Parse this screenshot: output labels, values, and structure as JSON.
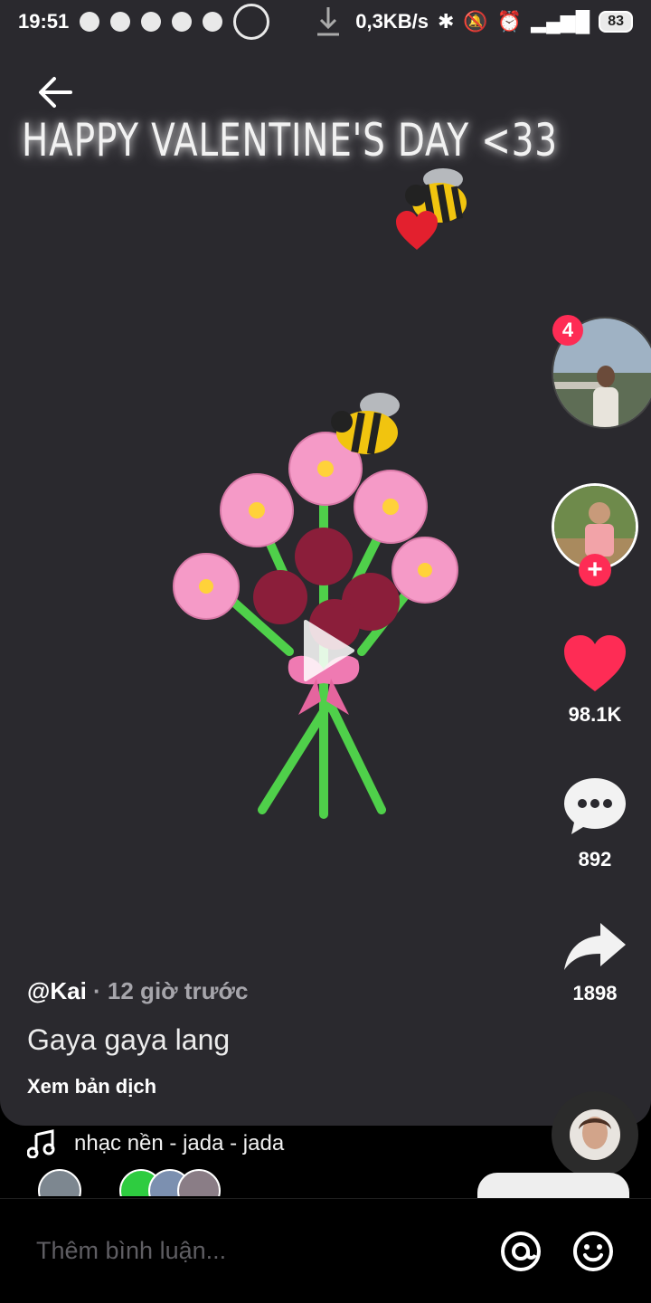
{
  "status_bar": {
    "time": "19:51",
    "network_speed": "0,3KB/s",
    "battery": "83"
  },
  "video": {
    "headline": "HAPPY VALENTINE'S DAY <33",
    "play_icon": "play-icon"
  },
  "side_rail": {
    "live_badge": "4",
    "likes": "98.1K",
    "comments": "892",
    "shares": "1898",
    "accent": "#fe2c55"
  },
  "caption": {
    "handle": "@Kai",
    "time_ago": " · 12 giờ trước",
    "description": "Gaya gaya lang",
    "translate": "Xem bản dịch"
  },
  "music": {
    "label": "nhạc nền - jada - jada"
  },
  "comment_bar": {
    "placeholder": "Thêm bình luận..."
  }
}
